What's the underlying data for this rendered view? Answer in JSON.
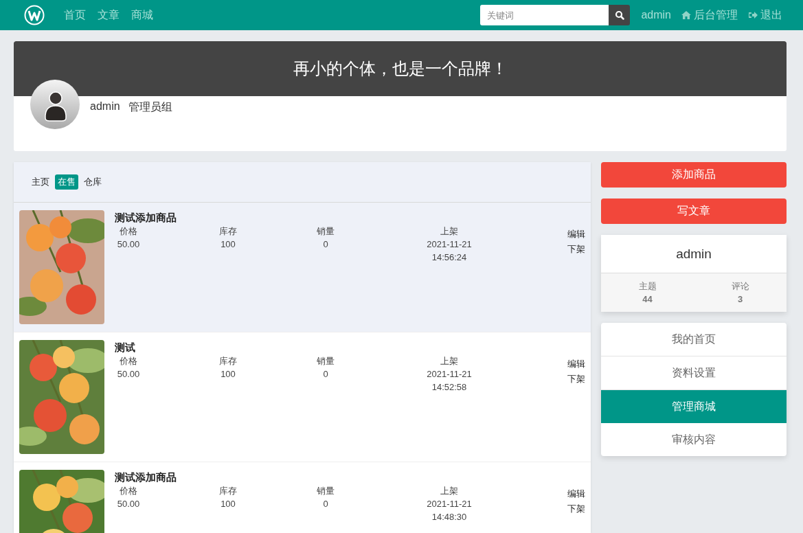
{
  "navbar": {
    "links": [
      {
        "label": "首页"
      },
      {
        "label": "文章"
      },
      {
        "label": "商城"
      }
    ],
    "search": {
      "placeholder": "关键词"
    },
    "user": "admin",
    "admin_link": "后台管理",
    "logout": "退出"
  },
  "profile": {
    "slogan": "再小的个体，也是一个品牌！",
    "username": "admin",
    "group": "管理员组"
  },
  "tabs": [
    {
      "label": "主页",
      "selected": false
    },
    {
      "label": "在售",
      "selected": true
    },
    {
      "label": "仓库",
      "selected": false
    }
  ],
  "products": [
    {
      "title": "测试添加商品",
      "highlighted": true,
      "image": {
        "kind": "picture"
      },
      "price_label": "价格",
      "price": "50.00",
      "stock_label": "库存",
      "stock": "100",
      "sales_label": "销量",
      "sales": "0",
      "listed_label": "上架",
      "listed_date": "2021-11-21",
      "listed_time": "14:56:24",
      "actions": [
        "编辑",
        "下架"
      ]
    },
    {
      "title": "测试",
      "highlighted": false,
      "image": {
        "kind": "picture"
      },
      "price_label": "价格",
      "price": "50.00",
      "stock_label": "库存",
      "stock": "100",
      "sales_label": "销量",
      "sales": "0",
      "listed_label": "上架",
      "listed_date": "2021-11-21",
      "listed_time": "14:52:58",
      "actions": [
        "编辑",
        "下架"
      ]
    },
    {
      "title": "测试添加商品",
      "highlighted": false,
      "image": {
        "kind": "picture"
      },
      "price_label": "价格",
      "price": "50.00",
      "stock_label": "库存",
      "stock": "100",
      "sales_label": "销量",
      "sales": "0",
      "listed_label": "上架",
      "listed_date": "2021-11-21",
      "listed_time": "14:48:30",
      "actions": [
        "编辑",
        "下架"
      ]
    }
  ],
  "sidebar": {
    "buttons": [
      "添加商品",
      "写文章"
    ],
    "user_card": {
      "name": "admin",
      "stats": [
        {
          "label": "主题",
          "value": "44"
        },
        {
          "label": "评论",
          "value": "3"
        }
      ]
    },
    "menu": [
      {
        "label": "我的首页",
        "selected": false
      },
      {
        "label": "资料设置",
        "selected": false
      },
      {
        "label": "管理商城",
        "selected": true
      },
      {
        "label": "审核内容",
        "selected": false
      }
    ]
  }
}
